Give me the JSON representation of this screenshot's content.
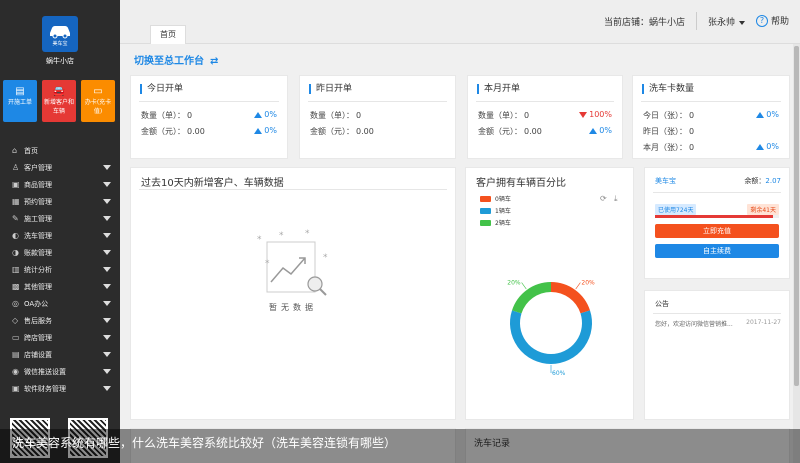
{
  "sidebar": {
    "logo_text": "美车宝",
    "shop_name": "蜗牛小店",
    "quick_actions": [
      {
        "icon": "document-icon",
        "glyph": "▤",
        "label": "开施工单"
      },
      {
        "icon": "car-icon",
        "glyph": "🚘",
        "label": "新增客户和车辆"
      },
      {
        "icon": "card-icon",
        "glyph": "▭",
        "label": "办卡(充卡值)"
      }
    ],
    "menu": [
      {
        "icon": "home-icon",
        "glyph": "⌂",
        "label": "首页",
        "expandable": false
      },
      {
        "icon": "customer-icon",
        "glyph": "♙",
        "label": "客户管理",
        "expandable": true
      },
      {
        "icon": "goods-icon",
        "glyph": "▣",
        "label": "商品管理",
        "expandable": true
      },
      {
        "icon": "calendar-icon",
        "glyph": "▦",
        "label": "预约管理",
        "expandable": true
      },
      {
        "icon": "wrench-icon",
        "glyph": "✎",
        "label": "施工管理",
        "expandable": true
      },
      {
        "icon": "car-wash-icon",
        "glyph": "◐",
        "label": "洗车管理",
        "expandable": true
      },
      {
        "icon": "account-icon",
        "glyph": "◑",
        "label": "账款管理",
        "expandable": true
      },
      {
        "icon": "chart-icon",
        "glyph": "▥",
        "label": "统计分析",
        "expandable": true
      },
      {
        "icon": "grid-icon",
        "glyph": "▩",
        "label": "其他管理",
        "expandable": true
      },
      {
        "icon": "oa-icon",
        "glyph": "◎",
        "label": "OA办公",
        "expandable": true
      },
      {
        "icon": "service-icon",
        "glyph": "◇",
        "label": "售后服务",
        "expandable": true
      },
      {
        "icon": "monitor-icon",
        "glyph": "▭",
        "label": "跨店管理",
        "expandable": true
      },
      {
        "icon": "settings-icon",
        "glyph": "▤",
        "label": "店铺设置",
        "expandable": true
      },
      {
        "icon": "wechat-icon",
        "glyph": "◉",
        "label": "微信推送设置",
        "expandable": true
      },
      {
        "icon": "software-icon",
        "glyph": "▣",
        "label": "软件财务管理",
        "expandable": true
      }
    ]
  },
  "topbar": {
    "tab_home": "首页",
    "store_label": "当前店铺：",
    "store_name": "蜗牛小店",
    "user_name": "张永帅",
    "help_label": "帮助"
  },
  "content": {
    "switch_label": "切换至总工作台",
    "switch_icon": "⇄",
    "cards": [
      {
        "title": "今日开单",
        "rows": [
          {
            "label": "数量（单）：",
            "value": "0",
            "pct": "0%",
            "dir": "up"
          },
          {
            "label": "金额（元）：",
            "value": "0.00",
            "pct": "0%",
            "dir": "up"
          }
        ]
      },
      {
        "title": "昨日开单",
        "rows": [
          {
            "label": "数量（单）：",
            "value": "0"
          },
          {
            "label": "金额（元）：",
            "value": "0.00"
          }
        ]
      },
      {
        "title": "本月开单",
        "rows": [
          {
            "label": "数量（单）：",
            "value": "0",
            "pct": "100%",
            "dir": "down"
          },
          {
            "label": "金额（元）：",
            "value": "0.00",
            "pct": "0%",
            "dir": "up"
          }
        ]
      },
      {
        "title": "洗车卡数量",
        "rows": [
          {
            "label": "今日（张）：",
            "value": "0",
            "pct": "0%",
            "dir": "up"
          },
          {
            "label": "昨日（张）：",
            "value": "0"
          },
          {
            "label": "本月（张）：",
            "value": "0",
            "pct": "0%",
            "dir": "up"
          }
        ]
      }
    ],
    "trend_title": "过去10天内新增客户、车辆数据",
    "empty_text": "暂无数据",
    "wallet": {
      "name": "美车宝",
      "balance_label": "余额：",
      "balance": "2.07",
      "used": "已使用724天",
      "remaining": "剩余41天",
      "used_fraction": 0.95,
      "charge_btn": "立即充值",
      "self_btn": "自主续费"
    },
    "notice": {
      "title": "公告",
      "text": "您好，欢迎访问微信营销推...",
      "date": "2017-11-27"
    },
    "wash_record_title": "洗车记录"
  },
  "chart_data": {
    "type": "pie",
    "title": "客户拥有车辆百分比",
    "donut": true,
    "series": [
      {
        "name": "0辆车",
        "value": 20,
        "label": "20%",
        "color": "#f4511e"
      },
      {
        "name": "1辆车",
        "value": 60,
        "label": "60%",
        "color": "#1e9bd7"
      },
      {
        "name": "2辆车",
        "value": 20,
        "label": "20%",
        "color": "#43c249"
      }
    ]
  },
  "caption": "洗车美容系统有哪些，什么洗车美容系统比较好（洗车美容连锁有哪些）"
}
